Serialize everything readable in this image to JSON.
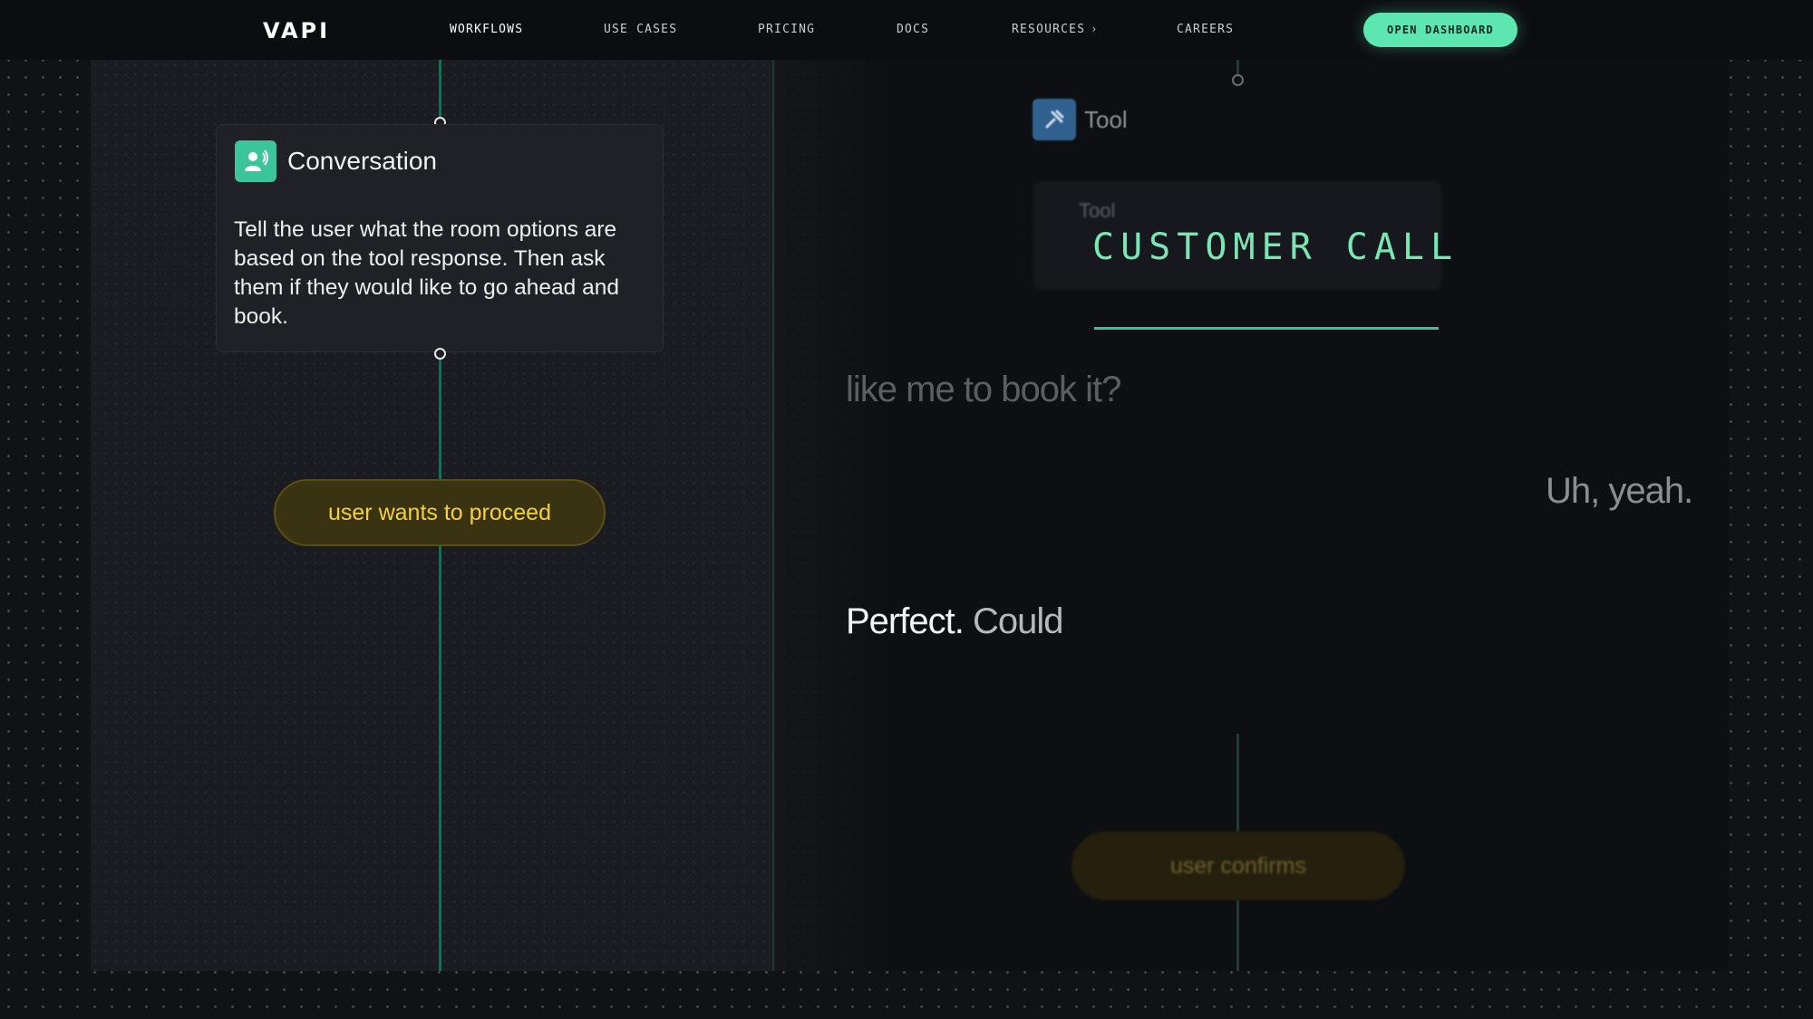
{
  "nav": {
    "logo": "VAPI",
    "links": [
      {
        "label": "WORKFLOWS"
      },
      {
        "label": "USE CASES"
      },
      {
        "label": "PRICING"
      },
      {
        "label": "DOCS"
      },
      {
        "label": "RESOURCES"
      },
      {
        "label": "CAREERS"
      }
    ],
    "cta": "OPEN DASHBOARD"
  },
  "workflow": {
    "conversation_node": {
      "title": "Conversation",
      "body": "Tell the user what the room options are based on the tool response. Then ask them if they would like to go ahead and book."
    },
    "edge_proceed": "user wants to proceed",
    "tool_node": {
      "title": "Tool",
      "subtitle": "Tool"
    },
    "edge_confirm": "user confirms"
  },
  "call": {
    "heading": "CUSTOMER CALL",
    "transcript": {
      "line1": "like me to book it?",
      "line2": "Uh, yeah.",
      "line3_bright": "Perfect.",
      "line3_dim": "Could"
    }
  },
  "colors": {
    "accent": "#5ee6b0",
    "edge_line": "#1f6a55",
    "pill_text": "#f4d03f",
    "conversation_icon": "#3cc59a",
    "tool_icon": "#31618f"
  }
}
